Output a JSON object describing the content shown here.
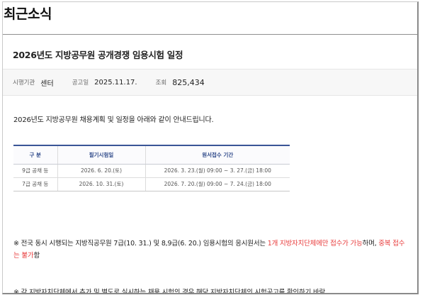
{
  "header": {
    "title": "최근소식"
  },
  "post": {
    "title": "2026년도 지방공무원 공개경쟁 임용시험 일정",
    "meta": {
      "org_label": "시행기관",
      "org_value": "센터",
      "date_label": "공고일",
      "date_value": "2025.11.17.",
      "views_label": "조회",
      "views_value": "825,434"
    },
    "intro": "2026년도 지방공무원 채용계획 및 일정을 아래와 같이 안내드립니다.",
    "table": {
      "headers": [
        "구 분",
        "필기시험일",
        "원서접수 기간"
      ],
      "rows": [
        [
          "9급 공채 등",
          "2026. 6. 20.(토)",
          "2026. 3. 23.(월) 09:00 ~ 3. 27.(금) 18:00"
        ],
        [
          "7급 공채 등",
          "2026. 10. 31.(토)",
          "2026. 7. 20.(월) 09:00 ~ 7. 24.(금) 18:00"
        ]
      ]
    },
    "notes": {
      "note1_a": "※ 전국 동시 시행되는 지방직공무원 7급(10. 31.) 및 8,9급(6. 20.) 임용시험의 응시원서는 ",
      "note1_red1": "1개 지방자치단체에만 접수가 가능",
      "note1_b": "하며, ",
      "note1_red2": "중복 접수는 불가",
      "note1_c": "함",
      "note2": "※ 각 지방자치단체에서 추가 및 별도로 실시하는 채용 시험의 경우 해당 지방자치단체의 시험공고를 확인하기 바람"
    }
  }
}
